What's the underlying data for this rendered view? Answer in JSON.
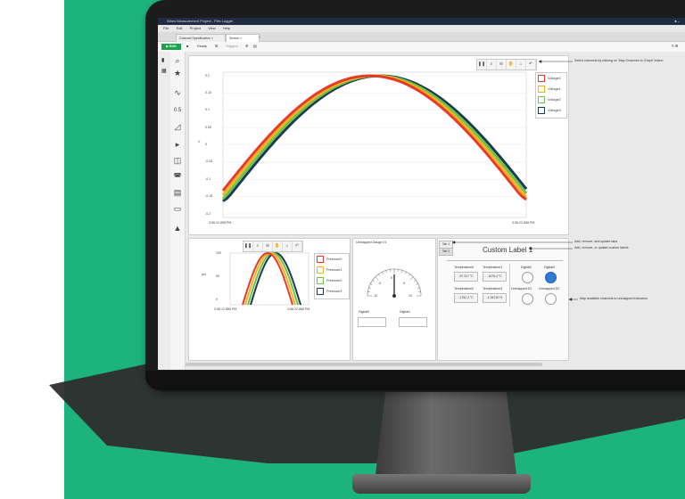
{
  "colors": {
    "background_green": "#1db37d",
    "run_green": "#1aa34a",
    "voltage0": "#e8392b",
    "voltage1": "#f5b21a",
    "voltage2": "#6cc24a",
    "voltage3": "#1b3a57"
  },
  "app": {
    "window_title": "Wired Measurement Project - Flex Logger",
    "menu": [
      "File",
      "Edit",
      "Project",
      "View",
      "Help"
    ],
    "tabs": [
      "Channel Specification",
      "Screen"
    ],
    "toolbar": {
      "run_label": "▶ RUN",
      "status": "Ready",
      "trigger_label": "Triggers"
    }
  },
  "main_graph": {
    "y_label": "V",
    "y_ticks": [
      "0.2",
      "0.15",
      "0.1",
      "0.05",
      "0",
      "-0.05",
      "-0.1",
      "-0.15",
      "-0.2"
    ],
    "x_start": "3:56:12.858 PM",
    "x_end": "3:56:22.858 PM",
    "legend": [
      "Voltage0",
      "Voltage1",
      "Voltage2",
      "Voltage3"
    ],
    "annotation": "Select channels by clicking on 'Map Channels to Graph' button"
  },
  "small_graph": {
    "y_label": "psi",
    "y_ticks": [
      "100",
      "50",
      "0"
    ],
    "x_start": "3:56:12.866 PM",
    "x_end": "3:56:22.866 PM",
    "legend": [
      "Pressure0",
      "Pressure1",
      "Pressure2",
      "Pressure3"
    ]
  },
  "gauge": {
    "title": "Unmapped Gauge 01",
    "ticks": [
      "-10",
      "-5",
      "0",
      "5",
      "10"
    ],
    "digital0": "Digital0",
    "digital1": "Digital1"
  },
  "tabs_panel": {
    "tab1": "Tab 1",
    "tab2": "Tab 2",
    "custom_label": "Custom Label 1",
    "temps": [
      {
        "label": "Temperature0",
        "value": "-97.317 °C"
      },
      {
        "label": "Temperature1",
        "value": "-1678.4 °C"
      },
      {
        "label": "Temperature2",
        "value": "-1752.2 °C"
      },
      {
        "label": "Temperature3",
        "value": "-1.0671E+3"
      }
    ],
    "digitals": [
      "Digital2",
      "Digital3",
      "Unmapped D1",
      "Unmapped D2"
    ],
    "ann_tabs": "Add, remove, and update tabs",
    "ann_labels": "Add, remove, or update custom labels",
    "ann_map": "Map available channels to unmapped indicators"
  }
}
